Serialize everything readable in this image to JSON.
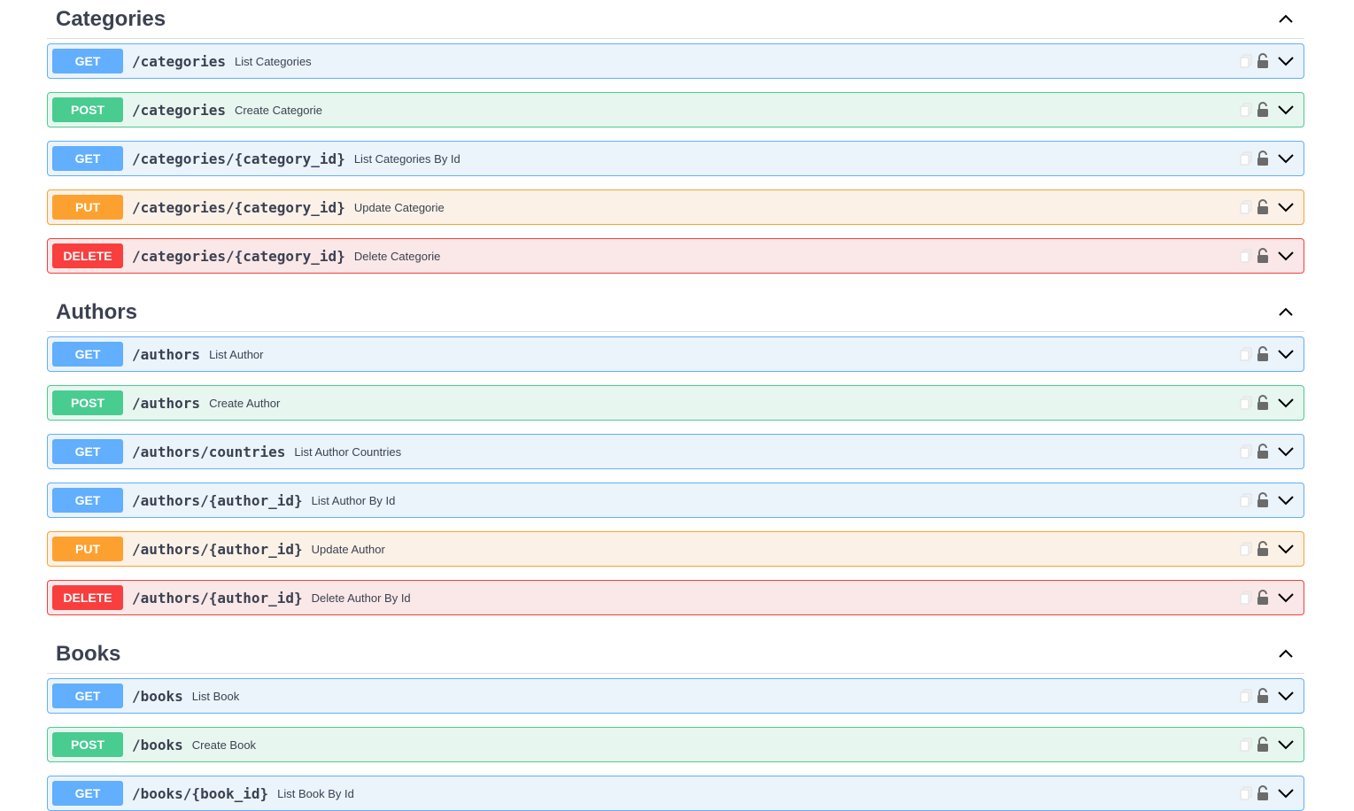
{
  "sections": [
    {
      "title": "Categories",
      "operations": [
        {
          "method": "GET",
          "path": "/categories",
          "summary": "List Categories"
        },
        {
          "method": "POST",
          "path": "/categories",
          "summary": "Create Categorie"
        },
        {
          "method": "GET",
          "path": "/categories/{category_id}",
          "summary": "List Categories By Id"
        },
        {
          "method": "PUT",
          "path": "/categories/{category_id}",
          "summary": "Update Categorie"
        },
        {
          "method": "DELETE",
          "path": "/categories/{category_id}",
          "summary": "Delete Categorie"
        }
      ]
    },
    {
      "title": "Authors",
      "operations": [
        {
          "method": "GET",
          "path": "/authors",
          "summary": "List Author"
        },
        {
          "method": "POST",
          "path": "/authors",
          "summary": "Create Author"
        },
        {
          "method": "GET",
          "path": "/authors/countries",
          "summary": "List Author Countries"
        },
        {
          "method": "GET",
          "path": "/authors/{author_id}",
          "summary": "List Author By Id"
        },
        {
          "method": "PUT",
          "path": "/authors/{author_id}",
          "summary": "Update Author"
        },
        {
          "method": "DELETE",
          "path": "/authors/{author_id}",
          "summary": "Delete Author By Id"
        }
      ]
    },
    {
      "title": "Books",
      "operations": [
        {
          "method": "GET",
          "path": "/books",
          "summary": "List Book"
        },
        {
          "method": "POST",
          "path": "/books",
          "summary": "Create Book"
        },
        {
          "method": "GET",
          "path": "/books/{book_id}",
          "summary": "List Book By Id"
        }
      ]
    }
  ],
  "icons": {
    "copy": "copy-icon",
    "lock": "lock-open-icon",
    "expand": "chevron-down-icon",
    "collapse": "chevron-up-icon"
  },
  "colors": {
    "get": "#61affe",
    "post": "#49cc90",
    "put": "#fca130",
    "delete": "#f93e3e"
  }
}
